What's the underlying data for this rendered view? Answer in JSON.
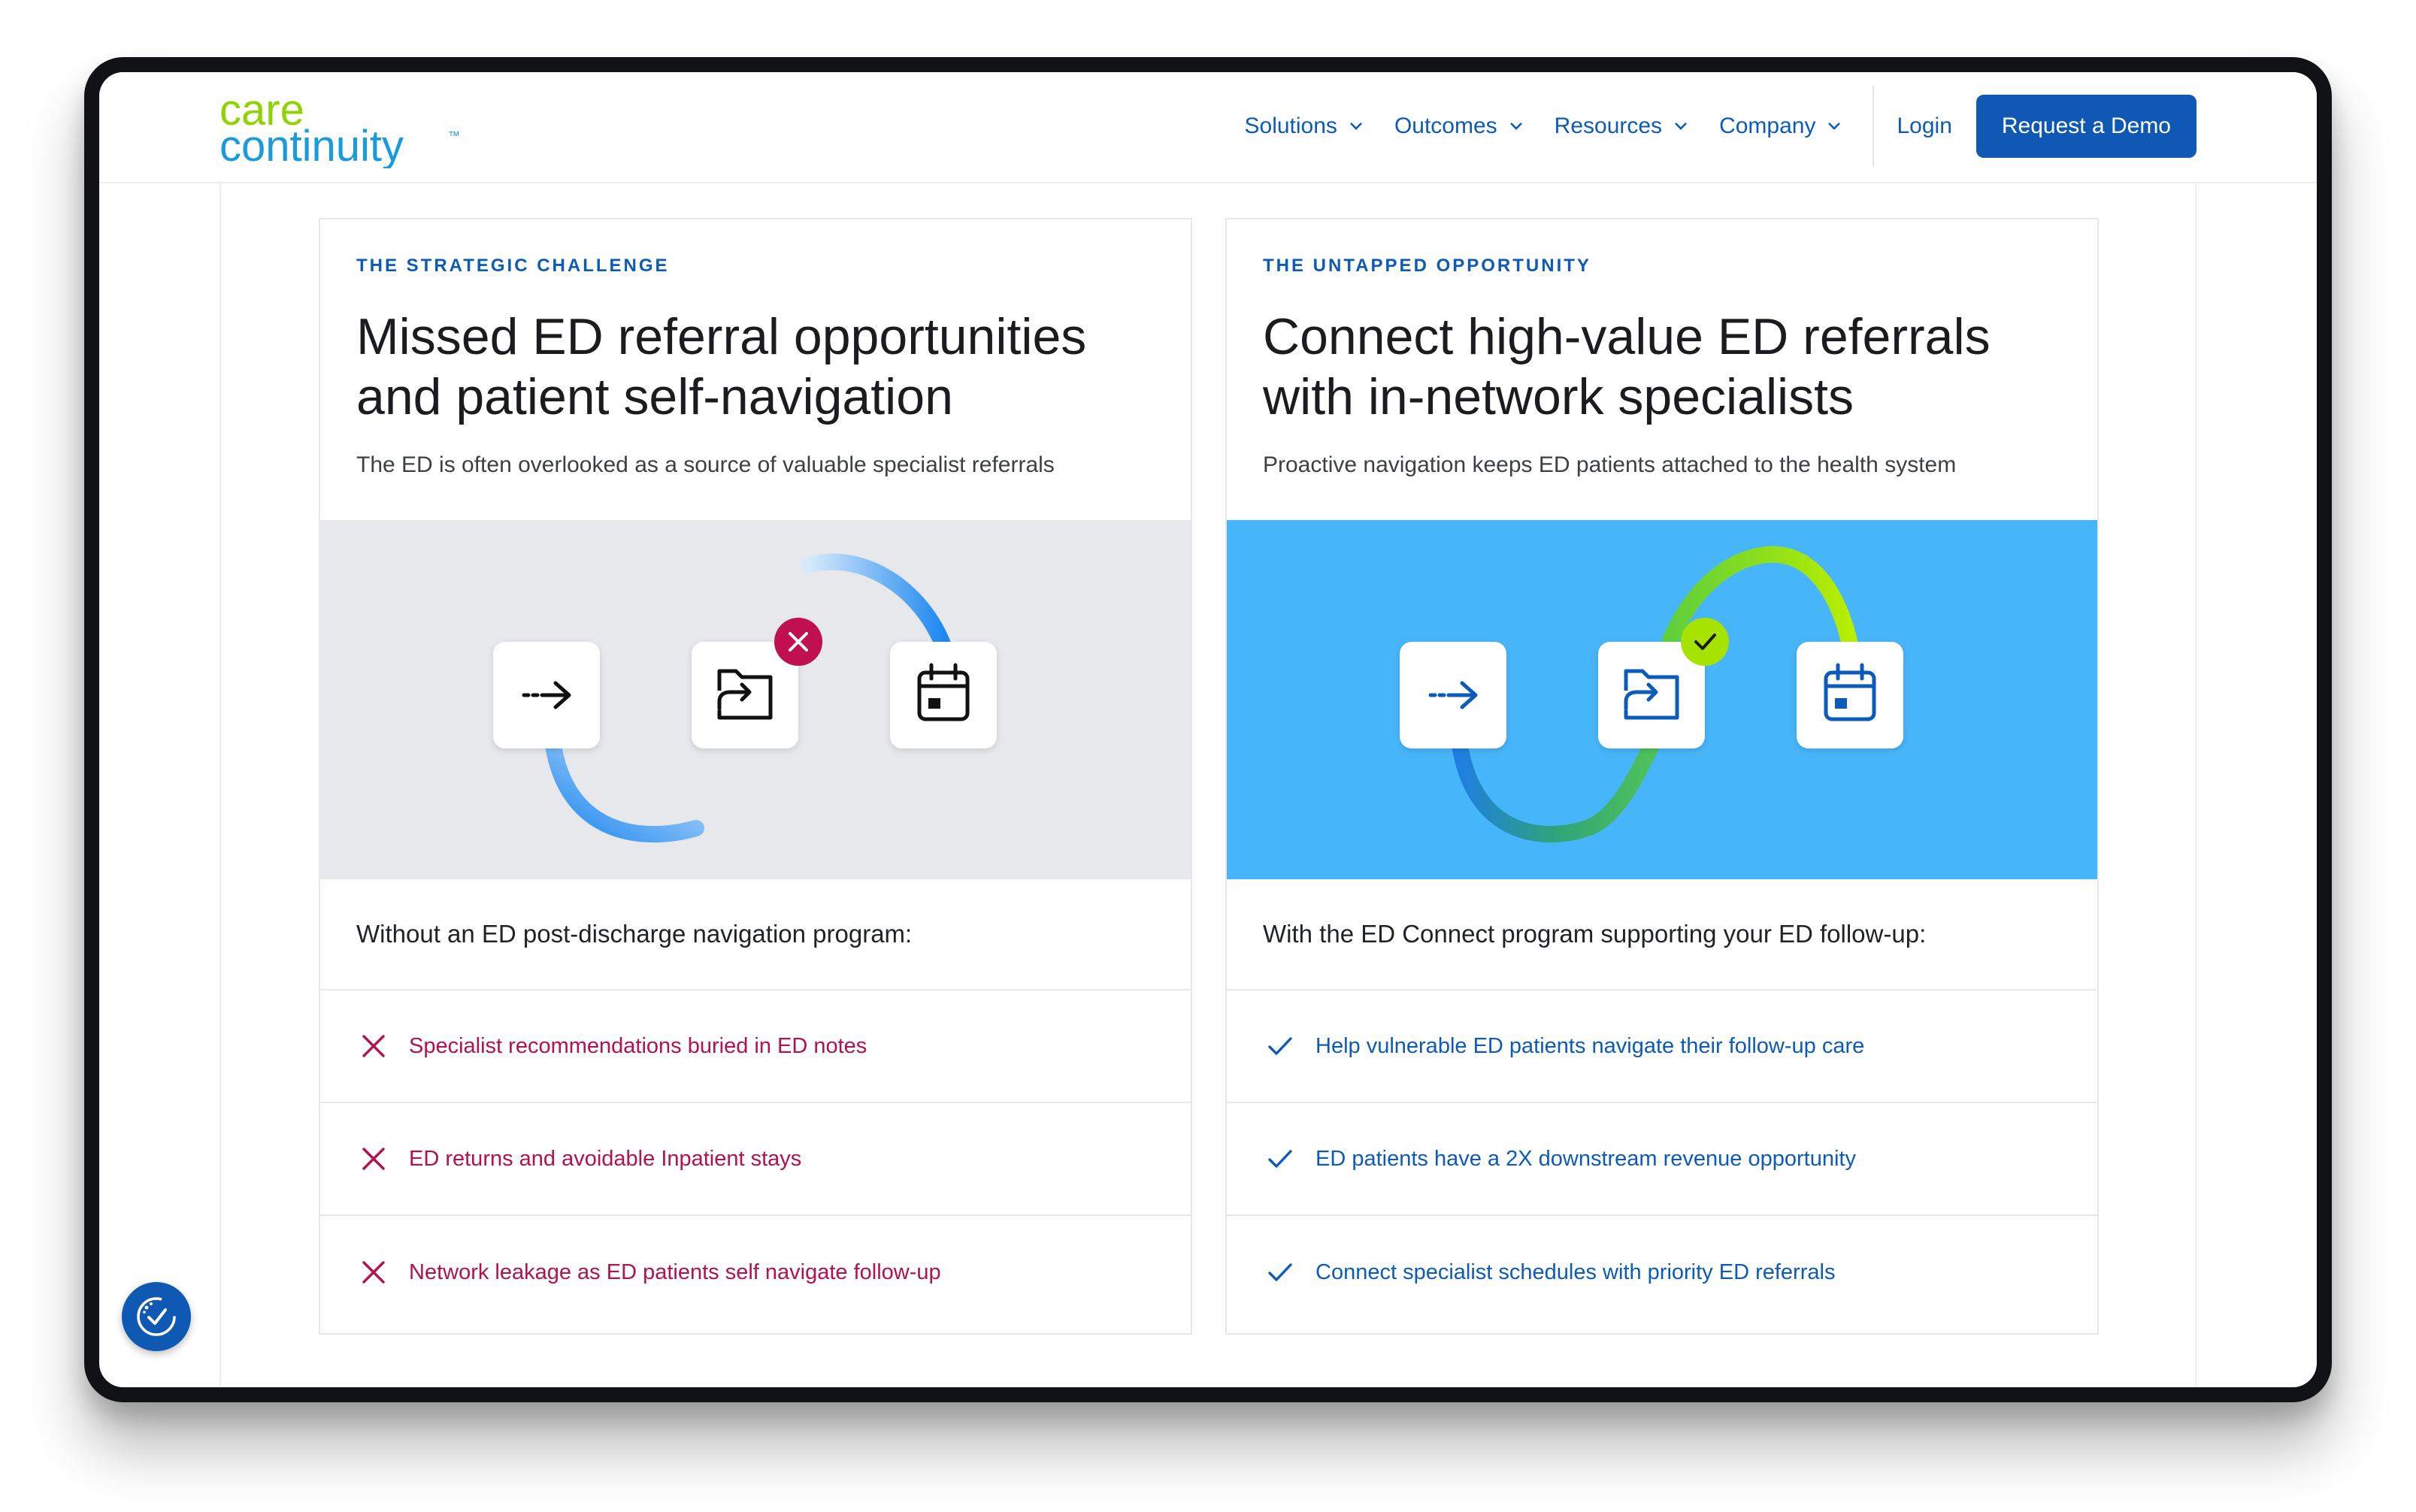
{
  "brand": {
    "logo_line1": "care",
    "logo_line2": "continuity",
    "logo_tm": "™",
    "colors": {
      "primary_blue": "#0f59b4",
      "accent_green": "#8fd400",
      "logo_blue": "#1a9bdc",
      "negative_red": "#b3114f",
      "sky_blue": "#47b5f9"
    }
  },
  "nav": {
    "items": [
      {
        "label": "Solutions",
        "icon": "chevron-down-icon"
      },
      {
        "label": "Outcomes",
        "icon": "chevron-down-icon"
      },
      {
        "label": "Resources",
        "icon": "chevron-down-icon"
      },
      {
        "label": "Company",
        "icon": "chevron-down-icon"
      }
    ],
    "login": "Login",
    "cta": "Request a Demo"
  },
  "cards": [
    {
      "eyebrow": "THE STRATEGIC CHALLENGE",
      "title_line1": "Missed ED referral opportunities",
      "title_line2": "and patient self-navigation",
      "subtitle": "The ED is often overlooked as a source of valuable specialist referrals",
      "illustration_icons": [
        "arrow-right-icon",
        "folder-referral-icon",
        "calendar-icon"
      ],
      "status_icon": "x-circle-icon",
      "lead": "Without an ED post-discharge navigation program:",
      "items": [
        "Specialist recommendations buried in ED notes",
        "ED returns and avoidable Inpatient stays",
        "Network leakage as ED patients self navigate follow-up"
      ]
    },
    {
      "eyebrow": "THE UNTAPPED OPPORTUNITY",
      "title_line1": "Connect high-value ED referrals",
      "title_line2": "with in-network specialists",
      "subtitle": "Proactive navigation keeps ED patients attached to the health system",
      "illustration_icons": [
        "arrow-right-icon",
        "folder-referral-icon",
        "calendar-icon"
      ],
      "status_icon": "check-circle-icon",
      "lead": "With the ED Connect program supporting your ED follow-up:",
      "items": [
        "Help vulnerable ED patients navigate their follow-up care",
        "ED patients have a 2X downstream revenue opportunity",
        "Connect specialist schedules with priority ED referrals"
      ]
    }
  ],
  "accessibility_button": {
    "icon": "accessibility-icon"
  }
}
